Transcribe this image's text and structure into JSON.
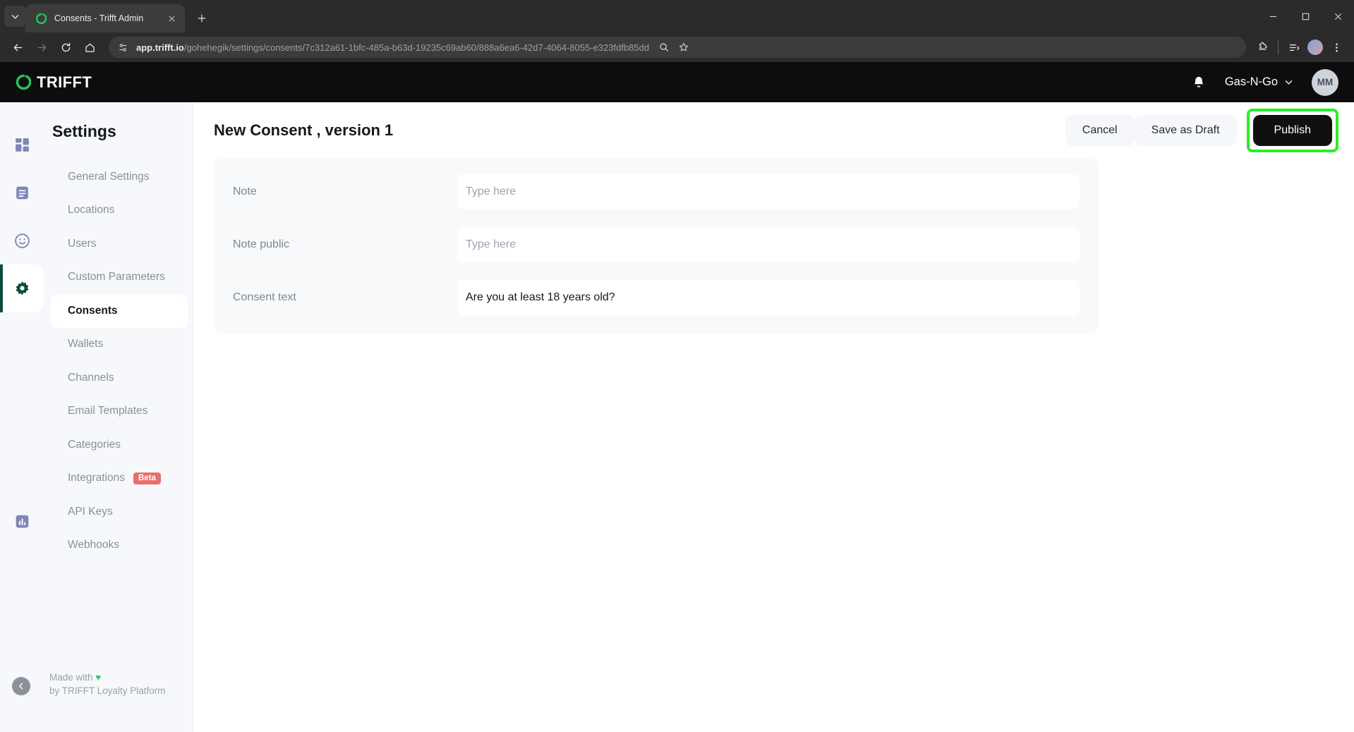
{
  "browser": {
    "tab": {
      "title": "Consents - Trifft Admin",
      "favicon_icon": "trifft-circle-icon",
      "close_icon": "close-icon"
    },
    "tab_list_icon": "chevron-down-icon",
    "new_tab_icon": "plus-icon",
    "window_controls": {
      "minimize_icon": "minimize-icon",
      "maximize_icon": "maximize-icon",
      "close_icon": "close-icon"
    },
    "nav": {
      "back_icon": "arrow-left-icon",
      "forward_icon": "arrow-right-icon",
      "reload_icon": "reload-icon",
      "home_icon": "home-icon"
    },
    "omnibox": {
      "site_info_icon": "page-settings-icon",
      "url_domain": "app.trifft.io",
      "url_path": "/gohehegik/settings/consents/7c312a61-1bfc-485a-b63d-19235c69ab60/888a6ea6-42d7-4064-8055-e323fdfb85dd",
      "zoom_icon": "zoom-icon",
      "bookmark_icon": "star-icon"
    },
    "toolbar": {
      "extensions_icon": "puzzle-icon",
      "split_icon": "split-screen-icon",
      "profile_icon": "profile-avatar-icon",
      "menu_icon": "three-dot-menu-icon"
    }
  },
  "app_header": {
    "logo_text": "TRIFFT",
    "logo_icon": "trifft-circle-icon",
    "notifications_icon": "bell-icon",
    "org_name": "Gas-N-Go",
    "org_chevron_icon": "chevron-down-icon",
    "user_initials": "MM"
  },
  "sidebar": {
    "title": "Settings",
    "rail": [
      {
        "name": "dashboard",
        "icon": "grid-icon",
        "active": false
      },
      {
        "name": "content",
        "icon": "document-icon",
        "active": false
      },
      {
        "name": "customers",
        "icon": "smiley-icon",
        "active": false
      },
      {
        "name": "settings",
        "icon": "gear-icon",
        "active": true
      }
    ],
    "rail_bottom": [
      {
        "name": "reports",
        "icon": "bar-chart-icon",
        "active": false
      }
    ],
    "items": [
      {
        "label": "General Settings",
        "active": false
      },
      {
        "label": "Locations",
        "active": false
      },
      {
        "label": "Users",
        "active": false
      },
      {
        "label": "Custom Parameters",
        "active": false
      },
      {
        "label": "Consents",
        "active": true
      },
      {
        "label": "Wallets",
        "active": false
      },
      {
        "label": "Channels",
        "active": false
      },
      {
        "label": "Email Templates",
        "active": false
      },
      {
        "label": "Categories",
        "active": false
      },
      {
        "label": "Integrations",
        "active": false,
        "badge": "Beta"
      },
      {
        "label": "API Keys",
        "active": false
      },
      {
        "label": "Webhooks",
        "active": false
      }
    ],
    "footer": {
      "collapse_icon": "chevron-left-icon",
      "line1_prefix": "Made with ",
      "heart": "♥",
      "line2": "by TRIFFT Loyalty Platform"
    }
  },
  "main": {
    "page_title": "New Consent , version 1",
    "actions": {
      "cancel_label": "Cancel",
      "save_draft_label": "Save as Draft",
      "publish_label": "Publish",
      "publish_highlight_color": "#27ef28"
    },
    "form": {
      "rows": [
        {
          "label": "Note",
          "value": "",
          "placeholder": "Type here"
        },
        {
          "label": "Note public",
          "value": "",
          "placeholder": "Type here"
        },
        {
          "label": "Consent text",
          "value": "Are you at least 18 years old?",
          "placeholder": "Type here"
        }
      ]
    }
  },
  "colors": {
    "accent_green": "#27ef28",
    "brand_green": "#22c55e",
    "header_black": "#0d0d0d",
    "sidebar_bg": "#f6f8fb",
    "badge_red": "#ea6f6a"
  }
}
